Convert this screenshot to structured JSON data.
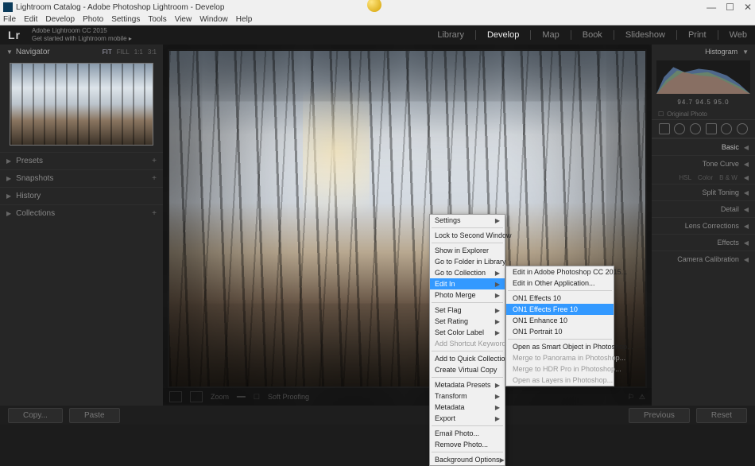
{
  "title": "Lightroom Catalog - Adobe Photoshop Lightroom - Develop",
  "menubar": [
    "File",
    "Edit",
    "Develop",
    "Photo",
    "Settings",
    "Tools",
    "View",
    "Window",
    "Help"
  ],
  "brand": {
    "line1": "Adobe Lightroom CC 2015",
    "line2": "Get started with Lightroom mobile  ▸"
  },
  "modules": [
    "Library",
    "Develop",
    "Map",
    "Book",
    "Slideshow",
    "Print",
    "Web"
  ],
  "active_module": "Develop",
  "left": {
    "navigator": "Navigator",
    "nav_modes": [
      "FIT",
      "FILL",
      "1:1",
      "3:1"
    ],
    "sections": [
      "Presets",
      "Snapshots",
      "History",
      "Collections"
    ]
  },
  "right": {
    "histogram": "Histogram",
    "histo_values": "94.7     94.5     95.0",
    "original_photo": "Original Photo",
    "sections": [
      "Basic",
      "Tone Curve",
      "Split Toning",
      "Detail",
      "Lens Corrections",
      "Effects",
      "Camera Calibration"
    ],
    "hsl": [
      "HSL",
      "Color",
      "B & W"
    ]
  },
  "bottom": {
    "zoom": "Zoom",
    "soft": "Soft Proofing"
  },
  "footer": {
    "copy": "Copy...",
    "paste": "Paste",
    "previous": "Previous",
    "reset": "Reset"
  },
  "context_menu": [
    {
      "label": "Settings",
      "arrow": true
    },
    {
      "sep": true
    },
    {
      "label": "Lock to Second Window"
    },
    {
      "sep": true
    },
    {
      "label": "Show in Explorer"
    },
    {
      "label": "Go to Folder in Library"
    },
    {
      "label": "Go to Collection",
      "arrow": true
    },
    {
      "label": "Edit In",
      "arrow": true,
      "highlight": true
    },
    {
      "label": "Photo Merge",
      "arrow": true
    },
    {
      "sep": true
    },
    {
      "label": "Set Flag",
      "arrow": true
    },
    {
      "label": "Set Rating",
      "arrow": true
    },
    {
      "label": "Set Color Label",
      "arrow": true
    },
    {
      "label": "Add Shortcut Keyword",
      "disabled": true
    },
    {
      "sep": true
    },
    {
      "label": "Add to Quick Collection"
    },
    {
      "label": "Create Virtual Copy"
    },
    {
      "sep": true
    },
    {
      "label": "Metadata Presets",
      "arrow": true
    },
    {
      "label": "Transform",
      "arrow": true
    },
    {
      "label": "Metadata",
      "arrow": true
    },
    {
      "label": "Export",
      "arrow": true
    },
    {
      "sep": true
    },
    {
      "label": "Email Photo..."
    },
    {
      "label": "Remove Photo..."
    },
    {
      "sep": true
    },
    {
      "label": "Background Options",
      "arrow": true
    }
  ],
  "submenu": [
    {
      "label": "Edit in Adobe Photoshop CC 2015..."
    },
    {
      "label": "Edit in Other Application..."
    },
    {
      "sep": true
    },
    {
      "label": "ON1 Effects 10"
    },
    {
      "label": "ON1 Effects Free 10",
      "highlight": true
    },
    {
      "label": "ON1 Enhance 10"
    },
    {
      "label": "ON1 Portrait 10"
    },
    {
      "sep": true
    },
    {
      "label": "Open as Smart Object in Photoshop..."
    },
    {
      "label": "Merge to Panorama in Photoshop...",
      "disabled": true
    },
    {
      "label": "Merge to HDR Pro in Photoshop...",
      "disabled": true
    },
    {
      "label": "Open as Layers in Photoshop...",
      "disabled": true
    }
  ]
}
